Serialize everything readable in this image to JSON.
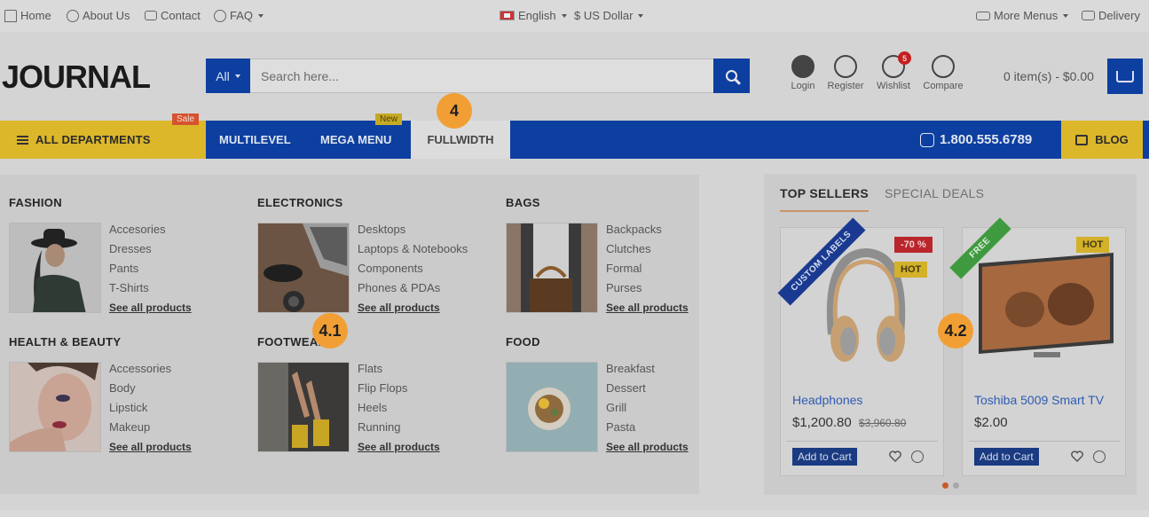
{
  "topbar": {
    "home": "Home",
    "about": "About Us",
    "contact": "Contact",
    "faq": "FAQ",
    "language": "English",
    "currency": "$ US Dollar",
    "more_menus": "More Menus",
    "delivery": "Delivery"
  },
  "header": {
    "logo": "JOURNAL",
    "search_category": "All",
    "search_placeholder": "Search here...",
    "login": "Login",
    "register": "Register",
    "wishlist": "Wishlist",
    "wishlist_count": "5",
    "compare": "Compare",
    "cart_text": "0 item(s) - $0.00"
  },
  "nav": {
    "all_departments": "ALL DEPARTMENTS",
    "sale_tag": "Sale",
    "multilevel": "MULTILEVEL",
    "mega_menu": "MEGA MENU",
    "new_tag": "New",
    "fullwidth": "FULLWIDTH",
    "phone": "1.800.555.6789",
    "blog": "BLOG"
  },
  "mega": {
    "categories": [
      {
        "title": "FASHION",
        "items": [
          "Accesories",
          "Dresses",
          "Pants",
          "T-Shirts"
        ],
        "see_all": "See all products"
      },
      {
        "title": "ELECTRONICS",
        "items": [
          "Desktops",
          "Laptops & Notebooks",
          "Components",
          "Phones & PDAs"
        ],
        "see_all": "See all products"
      },
      {
        "title": "BAGS",
        "items": [
          "Backpacks",
          "Clutches",
          "Formal",
          "Purses"
        ],
        "see_all": "See all products"
      },
      {
        "title": "HEALTH & BEAUTY",
        "items": [
          "Accessories",
          "Body",
          "Lipstick",
          "Makeup"
        ],
        "see_all": "See all products"
      },
      {
        "title": "FOOTWEAR",
        "items": [
          "Flats",
          "Flip Flops",
          "Heels",
          "Running"
        ],
        "see_all": "See all products"
      },
      {
        "title": "FOOD",
        "items": [
          "Breakfast",
          "Dessert",
          "Grill",
          "Pasta"
        ],
        "see_all": "See all products"
      }
    ]
  },
  "products": {
    "tabs": [
      "TOP SELLERS",
      "SPECIAL DEALS"
    ],
    "items": [
      {
        "name": "Headphones",
        "price": "$1,200.80",
        "old_price": "$3,960.80",
        "add_label": "Add to Cart",
        "ribbon": "CUSTOM LABELS",
        "labels": [
          "-70 %",
          "HOT"
        ]
      },
      {
        "name": "Toshiba 5009 Smart TV",
        "price": "$2.00",
        "old_price": "",
        "add_label": "Add to Cart",
        "ribbon": "FREE",
        "labels": [
          "HOT"
        ]
      }
    ]
  },
  "steps": {
    "s4": "4",
    "s41": "4.1",
    "s42": "4.2"
  },
  "colors": {
    "brand_blue": "#0d3fa0",
    "accent_yellow": "#dcb72a",
    "step_orange": "#f19f34",
    "sale_red": "#d6532f"
  }
}
